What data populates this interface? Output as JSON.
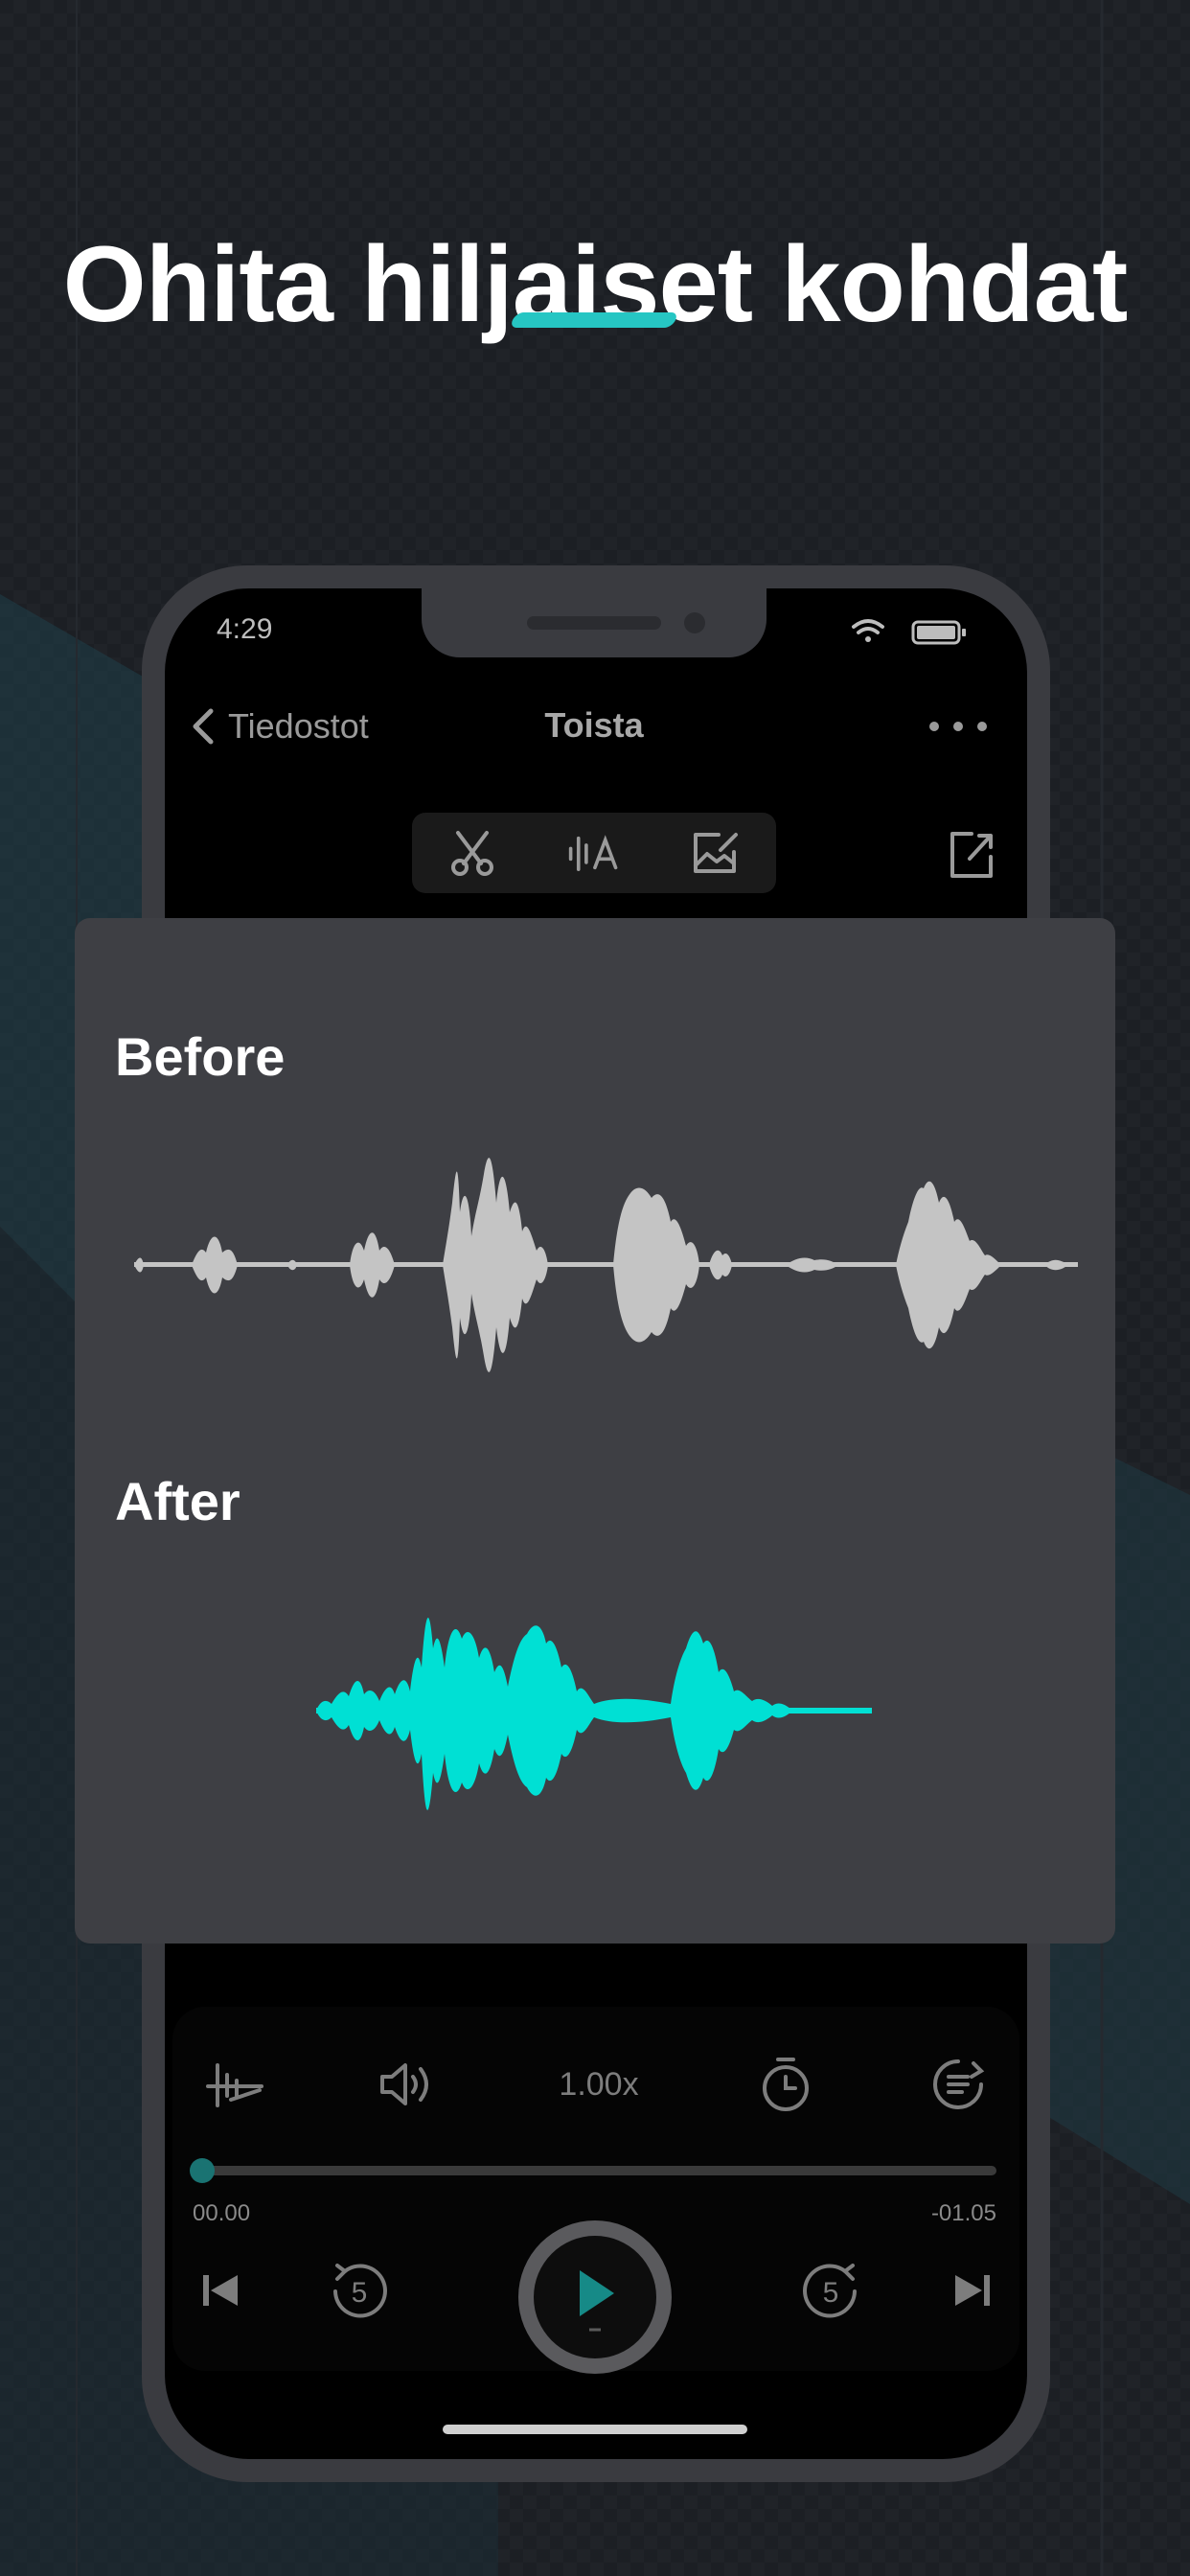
{
  "headline": "Ohita hiljaiset kohdat",
  "colors": {
    "accent": "#26c6c3",
    "waveform_before": "#c4c4c4",
    "waveform_after": "#00e0d4",
    "card": "#3e3f44"
  },
  "status_bar": {
    "time": "4:29",
    "icons": [
      "wifi-icon",
      "battery-icon"
    ]
  },
  "nav": {
    "back_label": "Tiedostot",
    "title": "Toista",
    "more_icon": "more-dots-icon"
  },
  "edit_tools": [
    "scissors-icon",
    "waveform-text-icon",
    "edit-image-icon"
  ],
  "share_icon": "share-icon",
  "comparison": {
    "before_label": "Before",
    "after_label": "After"
  },
  "player": {
    "controls": [
      "skip-silence-icon",
      "volume-icon",
      "speed",
      "sleep-timer-icon",
      "chapters-icon"
    ],
    "speed": "1.00x",
    "progress": 0,
    "time_elapsed": "00.00",
    "time_remaining": "-01.05",
    "skip_back_seconds": "5",
    "skip_forward_seconds": "5",
    "transport": [
      "previous-icon",
      "rewind-5-icon",
      "play-icon",
      "forward-5-icon",
      "next-icon"
    ]
  }
}
